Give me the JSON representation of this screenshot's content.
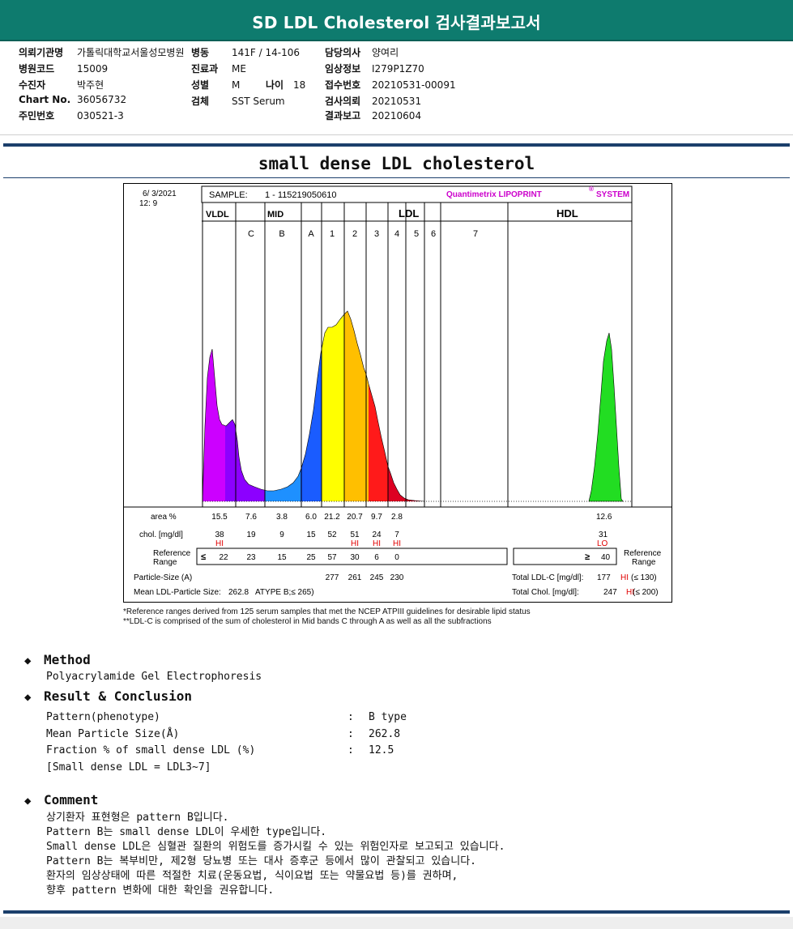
{
  "header": {
    "title": "SD LDL Cholesterol 검사결과보고서"
  },
  "patient_info": {
    "col1": [
      {
        "label": "의뢰기관명",
        "value": "가톨릭대학교서울성모병원"
      },
      {
        "label": "병원코드",
        "value": "15009"
      },
      {
        "label": "수진자",
        "value": "박주현"
      },
      {
        "label": "Chart No.",
        "value": "36056732"
      },
      {
        "label": "주민번호",
        "value": "030521-3"
      }
    ],
    "col2": [
      {
        "label": "병동",
        "value": "141F / 14-106"
      },
      {
        "label": "진료과",
        "value": "ME"
      },
      {
        "label": "성별",
        "value": "M"
      },
      {
        "label": "검체",
        "value": "SST Serum"
      }
    ],
    "age": {
      "label": "나이",
      "value": "18"
    },
    "col3": [
      {
        "label": "담당의사",
        "value": "양여리"
      },
      {
        "label": "임상정보",
        "value": "I279P1Z70"
      },
      {
        "label": "접수번호",
        "value": "20210531-00091"
      },
      {
        "label": "검사의뢰",
        "value": "20210531"
      },
      {
        "label": "결과보고",
        "value": "20210604"
      }
    ]
  },
  "section_title": "small dense LDL cholesterol",
  "chart_data": {
    "type": "area",
    "date_line1": "6/  3/2021",
    "date_line2": "12:  9",
    "sample_label": "SAMPLE:",
    "sample_id": "1 - 115219050610",
    "system_label": "Quantimetrix LIPOPRINT",
    "system_sup": "®",
    "system_suffix": "SYSTEM",
    "group_labels": {
      "vldl": "VLDL",
      "mid": "MID",
      "ldl": "LDL",
      "hdl": "HDL"
    },
    "band_labels": [
      "C",
      "B",
      "A",
      "1",
      "2",
      "3",
      "4",
      "5",
      "6",
      "7"
    ],
    "bands": [
      {
        "name": "VLDL",
        "color": "#cc00ff"
      },
      {
        "name": "MID C",
        "color": "#8c00ff"
      },
      {
        "name": "MID B",
        "color": "#1e90ff"
      },
      {
        "name": "MID A",
        "color": "#1a5cff"
      },
      {
        "name": "LDL1",
        "color": "#ffff00"
      },
      {
        "name": "LDL2",
        "color": "#ffbf00"
      },
      {
        "name": "LDL3",
        "color": "#ff1a1a"
      },
      {
        "name": "LDL4",
        "color": "#dd0022"
      },
      {
        "name": "LDL5",
        "color": "#c00020"
      },
      {
        "name": "LDL6",
        "color": "#a00018"
      },
      {
        "name": "LDL7",
        "color": "#800010"
      },
      {
        "name": "HDL",
        "color": "#22dd22"
      }
    ],
    "row_labels": {
      "area": "area %",
      "chol": "chol. [mg/dl]",
      "ref1": "Reference",
      "ref2": "Range",
      "ps": "Particle-Size (A)",
      "mean": "Mean LDL-Particle Size:",
      "tldl": "Total LDL-C [mg/dl]:",
      "tchol": "Total Chol. [mg/dl]:",
      "ref_right1": "Reference",
      "ref_right2": "Range"
    },
    "area_pct": [
      "15.5",
      "7.6",
      "3.8",
      "6.0",
      "21.2",
      "20.7",
      "9.7",
      "2.8"
    ],
    "hdl_area": "12.6",
    "chol": [
      "38",
      "19",
      "9",
      "15",
      "52",
      "51",
      "24",
      "7"
    ],
    "hdl_chol": "31",
    "flags": [
      "HI",
      "",
      "",
      "",
      "",
      "HI",
      "HI",
      "HI"
    ],
    "hdl_flag": "LO",
    "ref_prefix": "≤",
    "ref_values": [
      "22",
      "23",
      "15",
      "25",
      "57",
      "30",
      "6",
      "0"
    ],
    "hdl_ref_prefix": "≥",
    "hdl_ref": "40",
    "particle_size": [
      "277",
      "261",
      "245",
      "230"
    ],
    "mean_size": "262.8",
    "mean_type": "ATYPE B;≤ 265)",
    "total_ldl": "177",
    "total_ldl_flag": "HI",
    "total_ldl_ref": "(≤ 130)",
    "total_chol": "247",
    "total_chol_flag": "HI",
    "total_chol_ref": "(≤ 200)"
  },
  "footnotes": [
    "*Reference ranges derived from 125 serum samples that met the NCEP ATPIII guidelines for desirable lipid status",
    "**LDL-C is comprised of the sum of cholesterol in Mid bands C through A as well as all the subfractions"
  ],
  "method": {
    "heading": "Method",
    "text": "Polyacrylamide Gel Electrophoresis"
  },
  "result": {
    "heading": "Result & Conclusion",
    "rows": [
      {
        "key": "Pattern(phenotype)",
        "sep": ":",
        "value": "B type"
      },
      {
        "key": "Mean Particle Size(Å)",
        "sep": ":",
        "value": "262.8"
      },
      {
        "key": "Fraction % of small dense LDL (%)",
        "sep": ":",
        "value": "12.5"
      }
    ],
    "note": "[Small dense LDL = LDL3~7]"
  },
  "comment": {
    "heading": "Comment",
    "lines": [
      "상기환자 표현형은 pattern B입니다.",
      "Pattern B는 small dense LDL이 우세한 type입니다.",
      "Small dense LDL은 심혈관 질환의 위험도를 증가시킬 수 있는 위험인자로 보고되고 있습니다.",
      "Pattern B는 복부비만, 제2형 당뇨병 또는 대사 증후군 등에서 많이 관찰되고 있습니다.",
      "환자의 임상상태에 따른 적절한 치료(운동요법, 식이요법 또는 약물요법 등)를 권하며,",
      "향후 pattern 변화에 대한 확인을 권유합니다."
    ]
  },
  "icons": {
    "bullet": "diamond-icon"
  },
  "colors": {
    "title_bar": "#0e7b6e",
    "rule": "#1b3f6b",
    "flag": "#e00000",
    "system": "#cc00cc"
  }
}
